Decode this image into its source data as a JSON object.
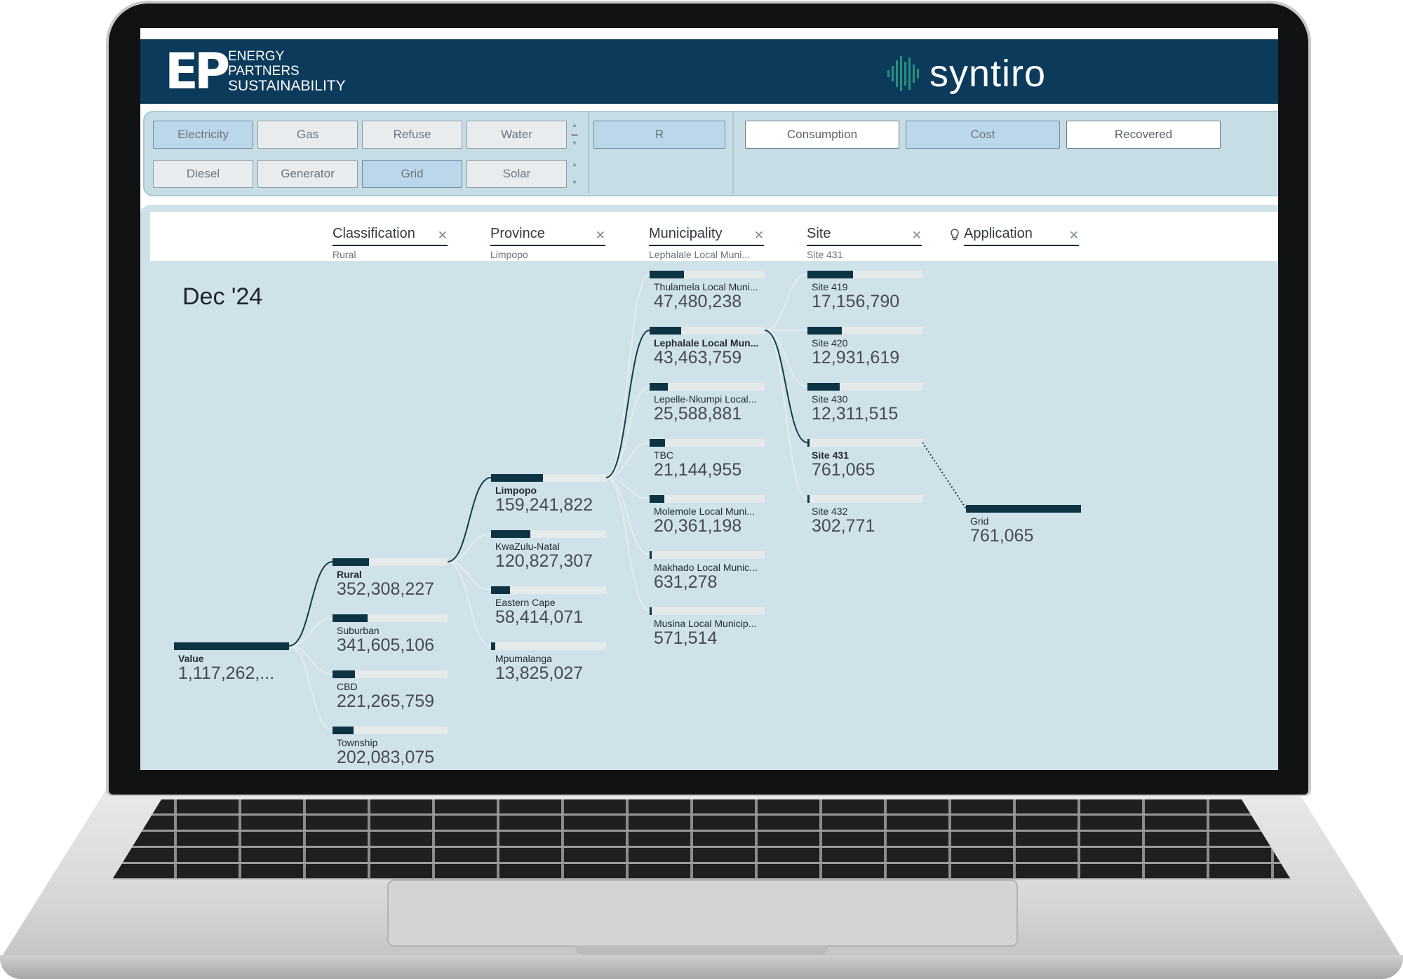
{
  "brand": {
    "ep_mark": "EP",
    "ep_lines": [
      "ENERGY",
      "PARTNERS",
      "SUSTAINABILITY"
    ],
    "product": "syntiro"
  },
  "colors": {
    "header": "#0b3a5b",
    "accent": "#0d3442",
    "panel": "#c7dde5"
  },
  "filters": {
    "utilities": [
      {
        "label": "Electricity",
        "selected": true
      },
      {
        "label": "Gas",
        "selected": false
      },
      {
        "label": "Refuse",
        "selected": false
      },
      {
        "label": "Water",
        "selected": false
      }
    ],
    "sources": [
      {
        "label": "Diesel",
        "selected": false
      },
      {
        "label": "Generator",
        "selected": false
      },
      {
        "label": "Grid",
        "selected": true
      },
      {
        "label": "Solar",
        "selected": false
      }
    ],
    "currency": {
      "label": "R",
      "selected": true
    },
    "measures": [
      {
        "label": "Consumption",
        "selected": false
      },
      {
        "label": "Cost",
        "selected": true
      },
      {
        "label": "Recovered",
        "selected": false
      }
    ]
  },
  "levels": [
    {
      "name": "Classification",
      "value": "Rural"
    },
    {
      "name": "Province",
      "value": "Limpopo"
    },
    {
      "name": "Municipality",
      "value": "Lephalale Local Muni..."
    },
    {
      "name": "Site",
      "value": "Site 431"
    },
    {
      "name": "Application",
      "value": ""
    }
  ],
  "period": "Dec '24",
  "chart_data": {
    "type": "decomposition-tree",
    "root": {
      "label": "Value",
      "value": "1,117,262,..."
    },
    "columns": [
      {
        "level": "Classification",
        "nodes": [
          {
            "label": "Rural",
            "value": 352308227,
            "display": "352,308,227",
            "expanded": true
          },
          {
            "label": "Suburban",
            "value": 341605106,
            "display": "341,605,106"
          },
          {
            "label": "CBD",
            "value": 221265759,
            "display": "221,265,759"
          },
          {
            "label": "Township",
            "value": 202083075,
            "display": "202,083,075"
          }
        ]
      },
      {
        "level": "Province",
        "nodes": [
          {
            "label": "Limpopo",
            "value": 159241822,
            "display": "159,241,822",
            "expanded": true
          },
          {
            "label": "KwaZulu-Natal",
            "value": 120827307,
            "display": "120,827,307"
          },
          {
            "label": "Eastern Cape",
            "value": 58414071,
            "display": "58,414,071"
          },
          {
            "label": "Mpumalanga",
            "value": 13825027,
            "display": "13,825,027"
          }
        ]
      },
      {
        "level": "Municipality",
        "nodes": [
          {
            "label": "Thulamela Local Muni...",
            "value": 47480238,
            "display": "47,480,238"
          },
          {
            "label": "Lephalale Local Mun...",
            "value": 43463759,
            "display": "43,463,759",
            "expanded": true
          },
          {
            "label": "Lepelle-Nkumpi Local...",
            "value": 25588881,
            "display": "25,588,881"
          },
          {
            "label": "TBC",
            "value": 21144955,
            "display": "21,144,955"
          },
          {
            "label": "Molemole Local Muni...",
            "value": 20361198,
            "display": "20,361,198"
          },
          {
            "label": "Makhado Local Munic...",
            "value": 631278,
            "display": "631,278"
          },
          {
            "label": "Musina Local Municip...",
            "value": 571514,
            "display": "571,514"
          }
        ]
      },
      {
        "level": "Site",
        "nodes": [
          {
            "label": "Site 419",
            "value": 17156790,
            "display": "17,156,790"
          },
          {
            "label": "Site 420",
            "value": 12931619,
            "display": "12,931,619"
          },
          {
            "label": "Site 430",
            "value": 12311515,
            "display": "12,311,515"
          },
          {
            "label": "Site 431",
            "value": 761065,
            "display": "761,065",
            "expanded": true
          },
          {
            "label": "Site 432",
            "value": 302771,
            "display": "302,771"
          }
        ]
      },
      {
        "level": "Application",
        "nodes": [
          {
            "label": "Grid",
            "value": 761065,
            "display": "761,065"
          }
        ]
      }
    ]
  }
}
